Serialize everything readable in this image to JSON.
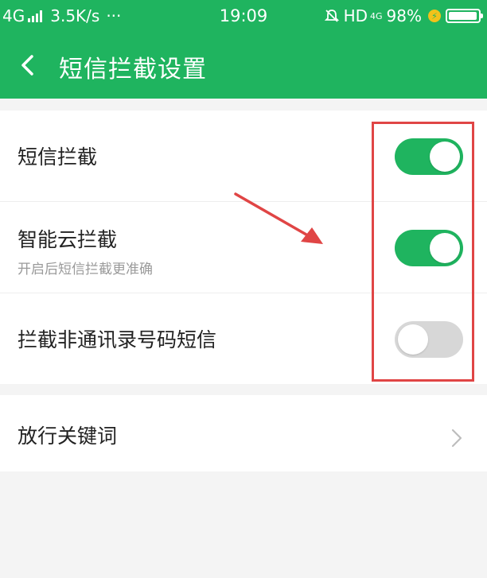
{
  "status_bar": {
    "network": "4G",
    "speed": "3.5K/s",
    "more": "···",
    "time": "19:09",
    "hd": "HD",
    "network_right": "4G",
    "battery": "98%",
    "battery_level": 0.98
  },
  "header": {
    "title": "短信拦截设置",
    "back_icon": "chevron-left-icon"
  },
  "settings": [
    {
      "label": "短信拦截",
      "subtitle": "",
      "enabled": true
    },
    {
      "label": "智能云拦截",
      "subtitle": "开启后短信拦截更准确",
      "enabled": true
    },
    {
      "label": "拦截非通讯录号码短信",
      "subtitle": "",
      "enabled": false
    }
  ],
  "keyword_row": {
    "label": "放行关键词",
    "icon": "chevron-right-icon"
  },
  "colors": {
    "brand_green": "#1fb45f",
    "toggle_off": "#d7d7d7",
    "annotation_red": "#e04545",
    "background": "#f4f4f4"
  }
}
